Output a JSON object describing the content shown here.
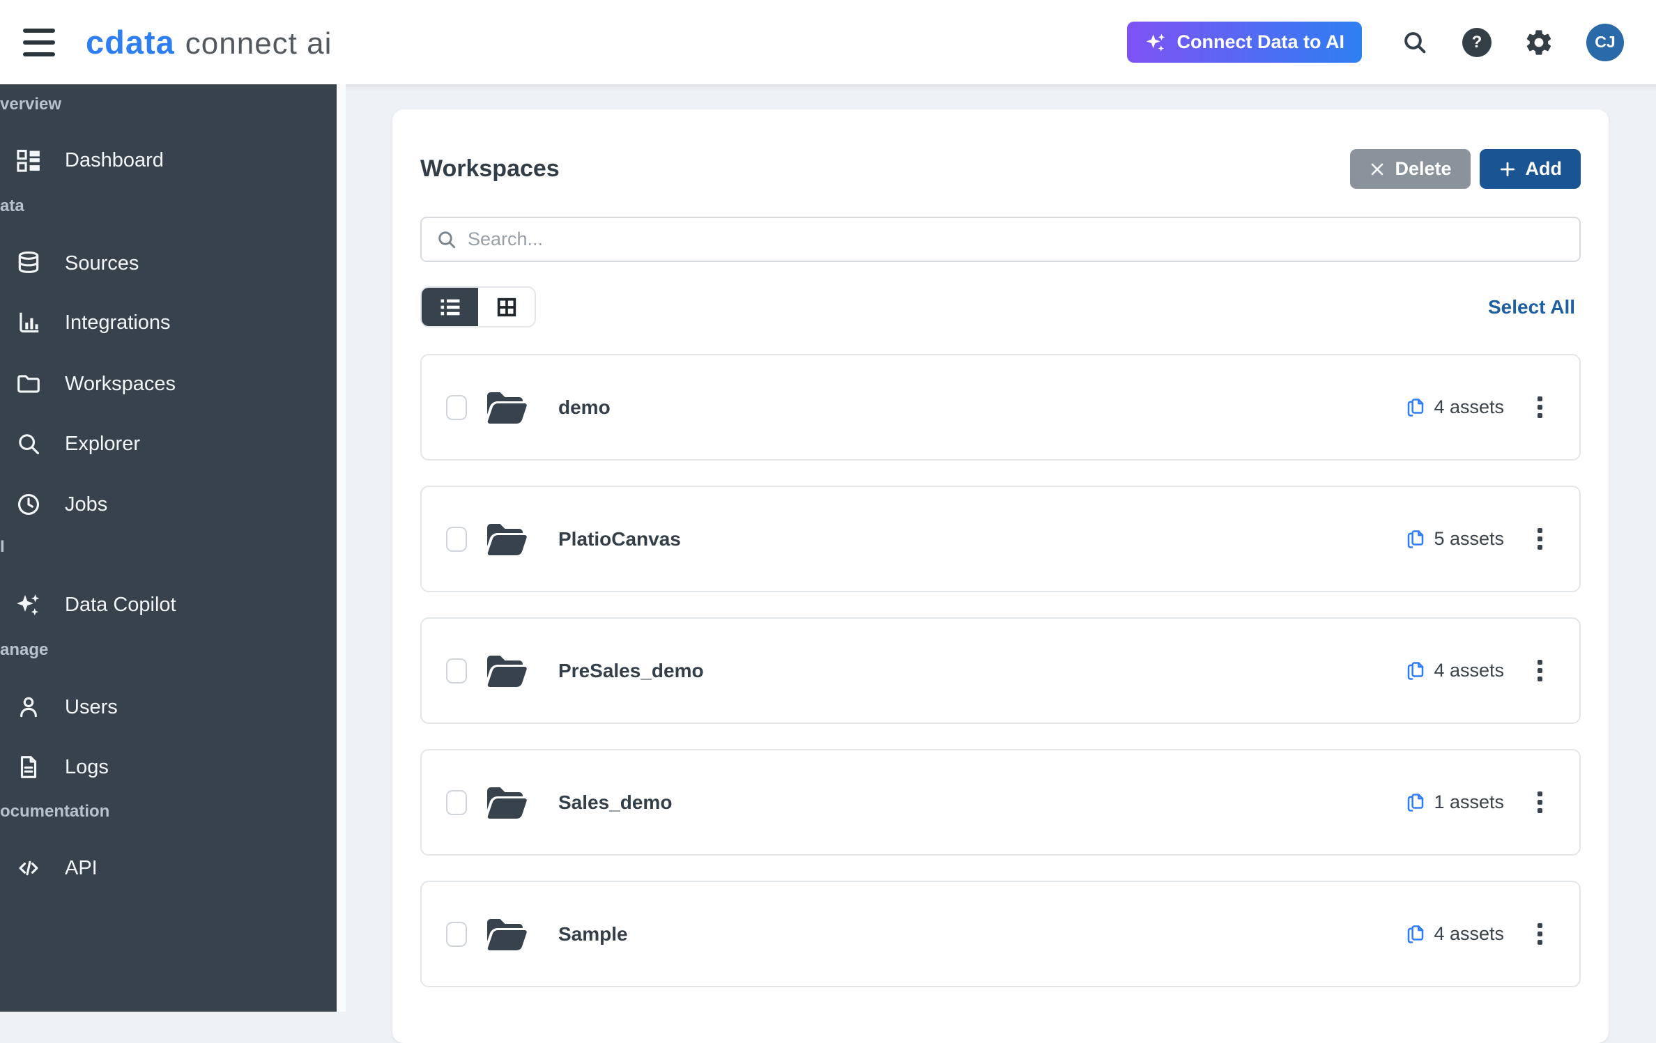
{
  "header": {
    "logo_primary": "cdata",
    "logo_secondary": "connect ai",
    "connect_ai_button": "Connect Data to AI",
    "help_glyph": "?",
    "avatar_initials": "CJ"
  },
  "sidebar": {
    "sections": [
      {
        "label": "verview"
      },
      {
        "label": "ata"
      },
      {
        "label": "I"
      },
      {
        "label": "anage"
      },
      {
        "label": "ocumentation"
      }
    ],
    "items": [
      {
        "label": "Dashboard"
      },
      {
        "label": "Sources"
      },
      {
        "label": "Integrations"
      },
      {
        "label": "Workspaces"
      },
      {
        "label": "Explorer"
      },
      {
        "label": "Jobs"
      },
      {
        "label": "Data Copilot"
      },
      {
        "label": "Users"
      },
      {
        "label": "Logs"
      },
      {
        "label": "API"
      }
    ]
  },
  "main": {
    "title": "Workspaces",
    "delete_button": "Delete",
    "add_button": "Add",
    "search_placeholder": "Search...",
    "select_all": "Select All",
    "workspaces": [
      {
        "name": "demo",
        "assets": "4 assets"
      },
      {
        "name": "PlatioCanvas",
        "assets": "5 assets"
      },
      {
        "name": "PreSales_demo",
        "assets": "4 assets"
      },
      {
        "name": "Sales_demo",
        "assets": "1 assets"
      },
      {
        "name": "Sample",
        "assets": "4 assets"
      }
    ]
  },
  "colors": {
    "sidebar_bg": "#37424c",
    "add_button_blue": "#1b5493",
    "delete_gray": "#8a929b",
    "link_blue": "#1e5fa0",
    "asset_icon_blue": "#2e7df6",
    "gradient_start": "#7e52f4",
    "gradient_end": "#2e7ff2",
    "main_bg": "#eef1f5"
  }
}
